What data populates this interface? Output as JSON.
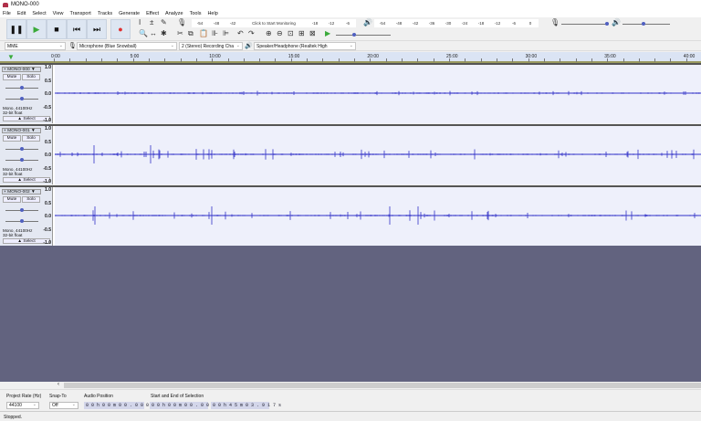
{
  "window": {
    "title": "MONO-000"
  },
  "menu": [
    "File",
    "Edit",
    "Select",
    "View",
    "Transport",
    "Tracks",
    "Generate",
    "Effect",
    "Analyze",
    "Tools",
    "Help"
  ],
  "transport": {
    "pause": "❚❚",
    "play": "▶",
    "stop": "■",
    "skip_start": "⏮",
    "skip_end": "⏭",
    "record": "●"
  },
  "tools": [
    "I",
    "±",
    "✎",
    "🔍",
    "↔",
    "✱"
  ],
  "edit_tools": [
    "✂",
    "⧉",
    "📋",
    "⊪",
    "⊫",
    "↶",
    "↷",
    "⊕",
    "⊖",
    "⊡",
    "⊞",
    "⊠",
    "▶"
  ],
  "record_meter": {
    "label": "Click to Start Monitoring",
    "ticks": [
      "-54",
      "-48",
      "-42",
      "-18",
      "-12",
      "-6",
      "0"
    ]
  },
  "playback_meter": {
    "ticks": [
      "-54",
      "-48",
      "-42",
      "-36",
      "-30",
      "-24",
      "-18",
      "-12",
      "-6",
      "0"
    ]
  },
  "devices": {
    "host": "MME",
    "input": "Microphone (Blue Snowball)",
    "channels": "2 (Stereo) Recording Cha",
    "output": "Speaker/Headphone (Realtek High"
  },
  "ruler": [
    "0:00",
    "5:00",
    "10:00",
    "15:00",
    "20:00",
    "25:00",
    "30:00",
    "35:00",
    "40:00"
  ],
  "tracks": [
    {
      "name": "MONO-000",
      "mute": "Mute",
      "solo": "Solo",
      "info1": "Mono, 44100Hz",
      "info2": "32-bit float",
      "select": "Select",
      "scale": [
        "1.0",
        "0.5",
        "0.0",
        "-0.5",
        "-1.0"
      ]
    },
    {
      "name": "MONO-001",
      "mute": "Mute",
      "solo": "Solo",
      "info1": "Mono, 44100Hz",
      "info2": "32-bit float",
      "select": "Select",
      "scale": [
        "1.0",
        "0.5",
        "0.0",
        "-0.5",
        "-1.0"
      ]
    },
    {
      "name": "MONO-002",
      "mute": "Mute",
      "solo": "Solo",
      "info1": "Mono, 44100Hz",
      "info2": "32-bit float",
      "select": "Select",
      "scale": [
        "1.0",
        "0.5",
        "0.0",
        "-0.5",
        "-1.0"
      ]
    }
  ],
  "bottom": {
    "rate_label": "Project Rate (Hz)",
    "rate": "44100",
    "snap_label": "Snap-To",
    "snap": "Off",
    "pos_label": "Audio Position",
    "pos": "0 0 h 0 0 m 0 0 . 0 0 0 s",
    "sel_label": "Start and End of Selection",
    "sel_start": "0 0 h 0 0 m 0 0 . 0 0 0 s",
    "sel_end": "0 0 h 4 5 m 0 3 . 9 1 7 s"
  },
  "status": "Stopped.",
  "colors": {
    "waveform": "#3232c8",
    "background": "#62637f",
    "record": "#e03030",
    "play": "#3aaa3a"
  }
}
